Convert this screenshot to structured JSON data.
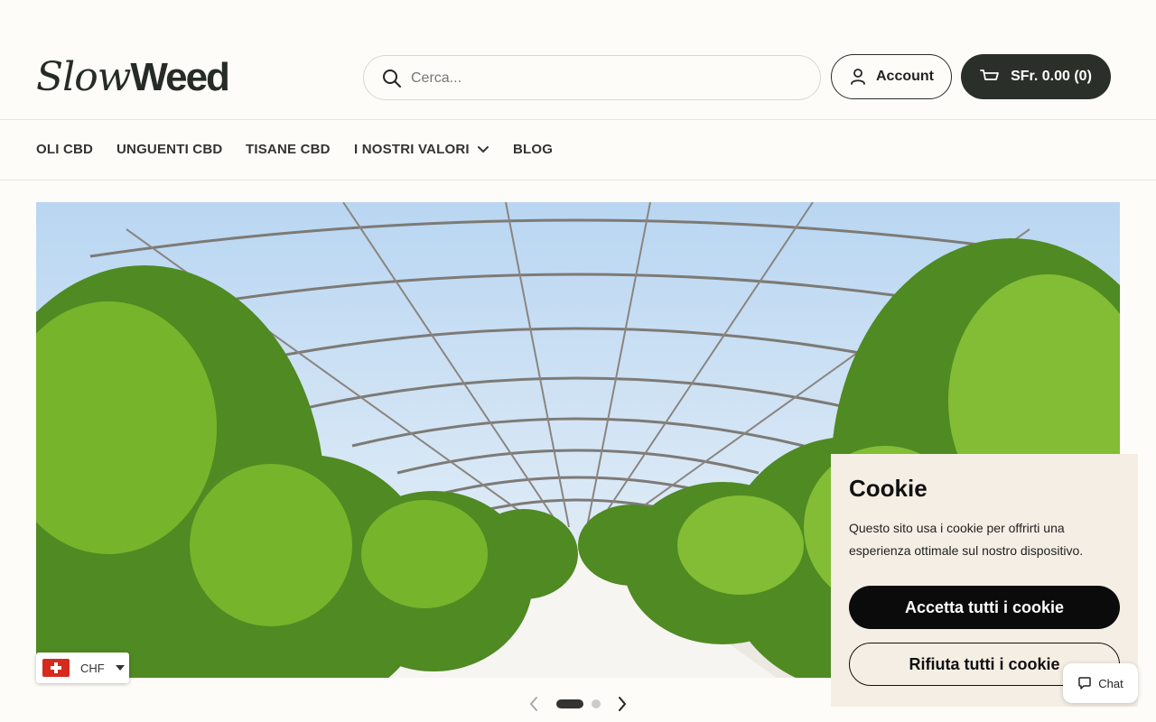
{
  "brand": {
    "logo_part1": "Slow",
    "logo_part2": "Weed"
  },
  "search": {
    "placeholder": "Cerca...",
    "icon": "search-icon"
  },
  "header": {
    "account_label": "Account",
    "cart_label": "SFr. 0.00 (0)",
    "account_icon": "user-icon",
    "cart_icon": "cart-icon",
    "cart_bg_color": "#2a2f2a"
  },
  "nav": {
    "items": [
      {
        "label": "OLI CBD"
      },
      {
        "label": "UNGUENTI CBD"
      },
      {
        "label": "TISANE CBD"
      },
      {
        "label": "I NOSTRI VALORI",
        "has_dropdown": true
      },
      {
        "label": "BLOG"
      }
    ]
  },
  "hero": {
    "description_icon": "greenhouse-image",
    "slide_count": 2,
    "active_slide": 1
  },
  "cookie": {
    "title": "Cookie",
    "text": "Questo sito usa i cookie per offrirti una esperienza ottimale sul nostro dispositivo.",
    "accept_label": "Accetta tutti i cookie",
    "reject_label": "Rifiuta tutti i cookie",
    "bg_color": "#f5eee4"
  },
  "currency": {
    "code": "CHF",
    "flag": "swiss-flag-icon"
  },
  "chat": {
    "label": "Chat",
    "icon": "chat-bubble-icon"
  }
}
